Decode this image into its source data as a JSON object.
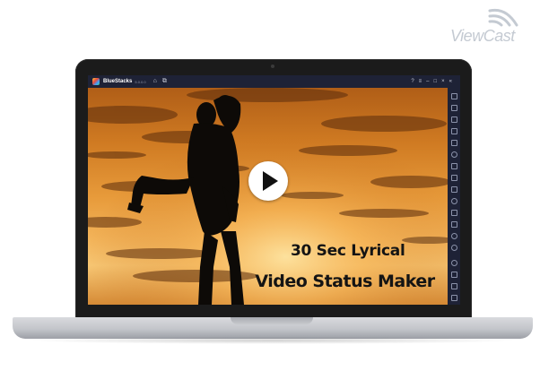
{
  "watermark": {
    "text": "ViewCast",
    "icon": "wifi-signal-icon",
    "color": "#c4cad2"
  },
  "window": {
    "app_name": "BlueStacks",
    "app_version": "5.0.0.0",
    "titlebar_icons_left": [
      "home-icon",
      "multi-instance-icon"
    ],
    "titlebar_icons_right": [
      "help-icon",
      "menu-icon",
      "minimize-icon",
      "maximize-icon",
      "close-icon",
      "collapse-sidebar-icon"
    ],
    "titlebar_color": "#1e2236"
  },
  "sidebar": {
    "icons": [
      "fullscreen-icon",
      "volume-up-icon",
      "volume-down-icon",
      "media-icon",
      "keyboard-icon",
      "rotate-icon",
      "shake-icon",
      "gamepad-icon",
      "screenshot-icon",
      "record-icon",
      "folder-icon",
      "multi-instance-icon",
      "eco-mode-icon",
      "sync-icon"
    ],
    "bottom_icons": [
      "settings-icon",
      "back-icon",
      "home-icon",
      "recent-apps-icon"
    ]
  },
  "video": {
    "play_icon": "play-icon",
    "title_line1": "30 Sec Lyrical",
    "title_line2": "Video Status Maker",
    "sky_colors": [
      "#b05e17",
      "#e79a3a",
      "#f7c673"
    ]
  }
}
